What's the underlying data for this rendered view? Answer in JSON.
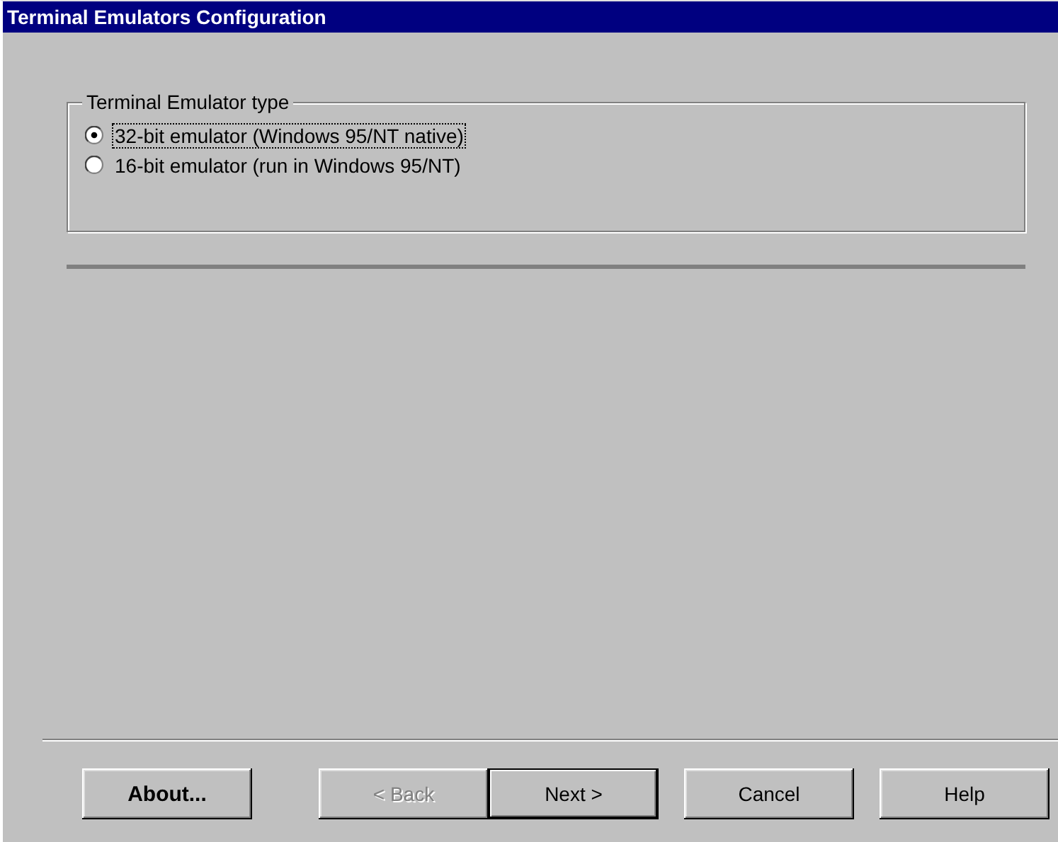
{
  "window": {
    "title": "Terminal Emulators Configuration"
  },
  "group": {
    "label": "Terminal Emulator type",
    "options": [
      {
        "label": "32-bit emulator (Windows 95/NT native)",
        "selected": true,
        "focused": true
      },
      {
        "label": "16-bit emulator (run in Windows 95/NT)",
        "selected": false,
        "focused": false
      }
    ]
  },
  "buttons": [
    {
      "label": "About...",
      "bold": true,
      "disabled": false,
      "default": false
    },
    {
      "label": "< Back",
      "bold": false,
      "disabled": true,
      "default": false
    },
    {
      "label": "Next >",
      "bold": false,
      "disabled": false,
      "default": true
    },
    {
      "label": "Cancel",
      "bold": false,
      "disabled": false,
      "default": false
    },
    {
      "label": "Help",
      "bold": false,
      "disabled": false,
      "default": false
    }
  ]
}
